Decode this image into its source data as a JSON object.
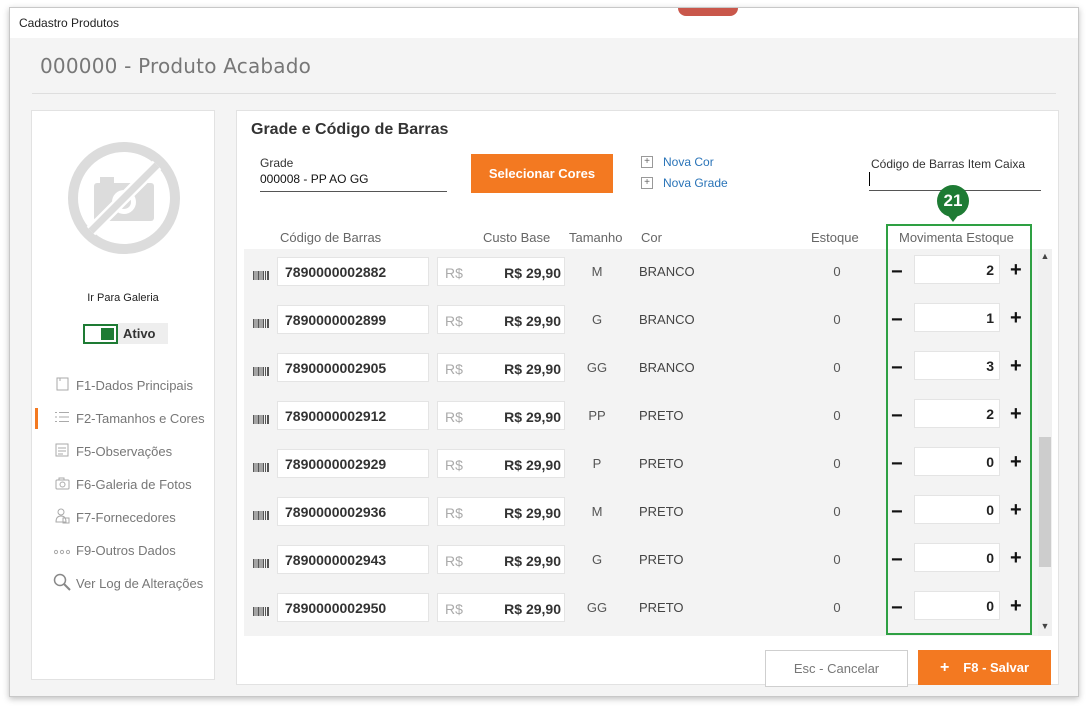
{
  "window": {
    "title": "Cadastro Produtos"
  },
  "header": {
    "title": "000000 - Produto Acabado"
  },
  "sidebar": {
    "gallery_link": "Ir Para Galeria",
    "status_label": "Ativo",
    "items": [
      {
        "label": "F1-Dados Principais",
        "icon": "document-icon"
      },
      {
        "label": "F2-Tamanhos  e Cores",
        "icon": "list-icon",
        "active": true
      },
      {
        "label": "F5-Observações",
        "icon": "notes-icon"
      },
      {
        "label": "F6-Galeria de Fotos",
        "icon": "camera-icon"
      },
      {
        "label": "F7-Fornecedores",
        "icon": "supplier-icon"
      },
      {
        "label": "F9-Outros Dados",
        "icon": "dots-icon"
      },
      {
        "label": "Ver Log de Alterações",
        "icon": "search-icon"
      }
    ]
  },
  "main": {
    "title": "Grade e Código de Barras",
    "grade_label": "Grade",
    "grade_value": "000008 - PP AO GG",
    "select_colors_button": "Selecionar Cores",
    "new_color_link": "Nova Cor",
    "new_grade_link": "Nova Grade",
    "barcode_label": "Código de Barras Item Caixa",
    "columns": {
      "barcode": "Código de Barras",
      "cost": "Custo Base",
      "size": "Tamanho",
      "color": "Cor",
      "stock": "Estoque",
      "movement": "Movimenta Estoque"
    },
    "rows": [
      {
        "code": "7890000002882",
        "currency": "R$",
        "cost": "R$ 29,90",
        "size": "M",
        "color": "BRANCO",
        "stock": "0",
        "qty": "2"
      },
      {
        "code": "7890000002899",
        "currency": "R$",
        "cost": "R$ 29,90",
        "size": "G",
        "color": "BRANCO",
        "stock": "0",
        "qty": "1"
      },
      {
        "code": "7890000002905",
        "currency": "R$",
        "cost": "R$ 29,90",
        "size": "GG",
        "color": "BRANCO",
        "stock": "0",
        "qty": "3"
      },
      {
        "code": "7890000002912",
        "currency": "R$",
        "cost": "R$ 29,90",
        "size": "PP",
        "color": "PRETO",
        "stock": "0",
        "qty": "2"
      },
      {
        "code": "7890000002929",
        "currency": "R$",
        "cost": "R$ 29,90",
        "size": "P",
        "color": "PRETO",
        "stock": "0",
        "qty": "0"
      },
      {
        "code": "7890000002936",
        "currency": "R$",
        "cost": "R$ 29,90",
        "size": "M",
        "color": "PRETO",
        "stock": "0",
        "qty": "0"
      },
      {
        "code": "7890000002943",
        "currency": "R$",
        "cost": "R$ 29,90",
        "size": "G",
        "color": "PRETO",
        "stock": "0",
        "qty": "0"
      },
      {
        "code": "7890000002950",
        "currency": "R$",
        "cost": "R$ 29,90",
        "size": "GG",
        "color": "PRETO",
        "stock": "0",
        "qty": "0"
      }
    ],
    "minus_symbol": "−",
    "plus_symbol": "+",
    "marker_number": "21"
  },
  "footer": {
    "cancel_button": "Esc - Cancelar",
    "save_plus": "+",
    "save_button": "F8 - Salvar"
  },
  "colors": {
    "accent": "#f37921",
    "highlight": "#2ea043",
    "active_toggle": "#1e7b34",
    "link": "#2a74b8"
  }
}
